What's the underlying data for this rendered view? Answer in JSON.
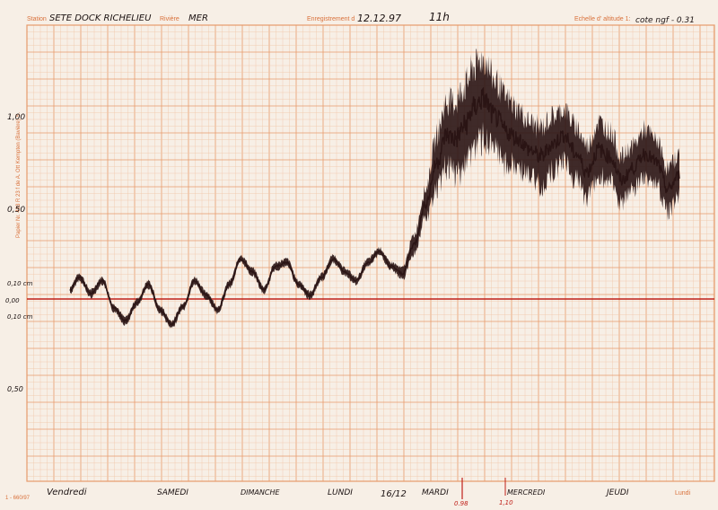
{
  "header": {
    "station_label": "Station",
    "station_value": "SETE DOCK RICHELIEU",
    "riviere_label": "Rivière",
    "riviere_value": "MER",
    "enregistrement_label": "Enregistrement d",
    "enregistrement_date": "12.12.97",
    "enregistrement_heure": "11h",
    "echelle_label": "Echelle d' altitude 1:",
    "echelle_value": "cote ngf - 0.31"
  },
  "side_print": "Papier Nr. 403 R 23 f de A. Ott Kempten (Bavière) S.",
  "corner_print": "1 - 660/97",
  "y_annotations": [
    "1,00",
    "0,50",
    "0,10 cm",
    "0,00",
    "0,10 cm",
    "0,50"
  ],
  "days": [
    "Vendredi",
    "SAMEDI",
    "DIMANCHE",
    "LUNDI",
    "16/12",
    "MARDI",
    "MERCREDI",
    "JEUDI",
    "Lundi"
  ],
  "marker_labels": [
    "0.98",
    "1,10"
  ],
  "colors": {
    "paper": "#f7efe6",
    "grid_major": "#e79a6b",
    "grid_minor": "#f1c5a6",
    "print": "#d9703a",
    "trace": "#2a1414",
    "reference_line": "#c0201a"
  },
  "chart_data": {
    "type": "line",
    "title": "",
    "xlabel": "",
    "ylabel": "",
    "reference_line": 0,
    "ylim": [
      -0.55,
      1.2
    ],
    "xlim": [
      0,
      14
    ],
    "series": [
      {
        "x": [
          0,
          0.2,
          0.45,
          0.7,
          0.95,
          1.2,
          1.45,
          1.7,
          1.95,
          2.2,
          2.45,
          2.7,
          2.95,
          3.2,
          3.45,
          3.7,
          3.95,
          4.2,
          4.45,
          4.7,
          4.95,
          5.2,
          5.45,
          5.7,
          5.95,
          6.2,
          6.45,
          6.7,
          6.95,
          7.2,
          7.45,
          7.7,
          7.95,
          8.15,
          8.35,
          8.55,
          8.75,
          8.95,
          9.2,
          9.45,
          9.7,
          9.95,
          10.2,
          10.45,
          10.7,
          10.95,
          11.2,
          11.45,
          11.7,
          11.95,
          12.2,
          12.45,
          12.7,
          12.95,
          13.2
        ],
        "y": [
          0.05,
          0.12,
          0.03,
          0.1,
          -0.05,
          -0.12,
          -0.02,
          0.08,
          -0.06,
          -0.14,
          -0.04,
          0.1,
          0.02,
          -0.06,
          0.08,
          0.22,
          0.15,
          0.05,
          0.18,
          0.2,
          0.08,
          0.02,
          0.12,
          0.22,
          0.15,
          0.1,
          0.2,
          0.26,
          0.18,
          0.14,
          0.3,
          0.52,
          0.75,
          0.9,
          0.88,
          0.95,
          1.05,
          1.1,
          1.0,
          0.92,
          0.88,
          0.82,
          0.78,
          0.85,
          0.9,
          0.8,
          0.7,
          0.82,
          0.78,
          0.65,
          0.72,
          0.8,
          0.75,
          0.6,
          0.68
        ],
        "amplitude": [
          0.02,
          0.02,
          0.02,
          0.02,
          0.02,
          0.02,
          0.02,
          0.02,
          0.02,
          0.02,
          0.02,
          0.02,
          0.02,
          0.02,
          0.02,
          0.02,
          0.02,
          0.02,
          0.02,
          0.02,
          0.02,
          0.02,
          0.02,
          0.02,
          0.02,
          0.02,
          0.02,
          0.02,
          0.02,
          0.03,
          0.05,
          0.08,
          0.15,
          0.18,
          0.2,
          0.22,
          0.22,
          0.22,
          0.2,
          0.18,
          0.16,
          0.15,
          0.16,
          0.15,
          0.14,
          0.15,
          0.14,
          0.15,
          0.14,
          0.13,
          0.12,
          0.13,
          0.12,
          0.12,
          0.11
        ]
      }
    ]
  }
}
